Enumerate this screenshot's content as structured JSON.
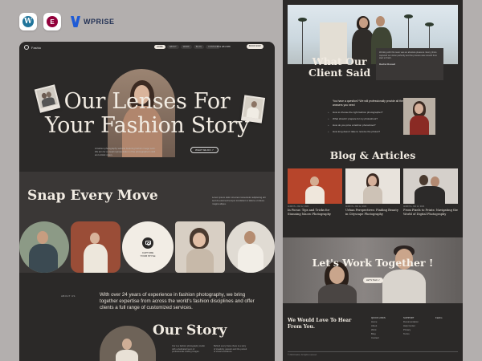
{
  "brand_logos": {
    "wordpress_icon": "W",
    "elementor_icon": "E",
    "wprise_label": "WPRISE"
  },
  "left_page": {
    "brand": "Fashio",
    "nav": [
      "HOME",
      "ABOUT",
      "WORK",
      "BLOG",
      "CONTACT"
    ],
    "phone": "073 284 888",
    "cta": "BOOK NOW",
    "hero": {
      "title_line1": "Our Lenses For",
      "title_line2": "Your Fashion Story",
      "description": "A fashion photography website featuring fashion image work. We aim for a visual representation of the photographer's skill and artistic vision.",
      "button": "WHAT WE DO ↗"
    },
    "snap": {
      "title": "Snap Every Move",
      "description": "Lorem ipsum dolor sit amet consectetur adipiscing elit sed do eiusmod tempor incididunt ut labore et dolore magna aliqua."
    },
    "capture": {
      "line1": "CAPTURE",
      "line2": "YOUR STYLE"
    },
    "about": {
      "label": "ABOUT US",
      "text": "With over 24 years of experience in fashion photography, we bring together expertise from across the world's fashion disciplines and offer clients a full range of customized services."
    },
    "story": {
      "title": "Our Story",
      "col1": "Our is a fashion photography studio with a dedicated team of professionals crafting images.",
      "col2": "Behind every frame there is a story of creativity, passion and the pursuit of visual excellence."
    }
  },
  "right_page": {
    "client": {
      "title_line1": "What Our",
      "title_line2": "Client Said",
      "quote": "Working with this team was an absolute pleasure. Every photo captured our vision perfectly and the process was smooth from start to finish.",
      "name": "Rachel Russell"
    },
    "faq": {
      "head": "You have a question? We will professionally provide all the answers you need",
      "questions": [
        "How to choose the right fashion photographer?",
        "What should I prepare for my photoshoot?",
        "How do you price a fashion photoshoot?",
        "How long does it take to receive the photos?"
      ]
    },
    "blog": {
      "title": "Blog & Articles",
      "posts": [
        {
          "meta": "ALWAYS • JAN 12, 2024",
          "title": "In Focus: Tips and Tricks for Stunning Macro Photography"
        },
        {
          "meta": "ALWAYS • JAN 12, 2024",
          "title": "Urban Perspectives: Finding Beauty in Cityscape Photography"
        },
        {
          "meta": "ALWAYS • JAN 12, 2024",
          "title": "From Pixels to Prints: Navigating the World of Digital Photography"
        }
      ]
    },
    "work": {
      "title": "Let's Work Together !",
      "button": "LET'S TALK ↗"
    },
    "footer": {
      "title_line1": "We Would Love To Hear",
      "title_line2": "From You.",
      "col1_head": "QUICK LINKS",
      "col1": [
        "Home",
        "About",
        "Work",
        "Blog",
        "Contact"
      ],
      "col2_head": "SUPPORT",
      "col2": [
        "Documentation",
        "Help Center",
        "Privacy",
        "Terms"
      ],
      "brand": "Fashio",
      "copyright": "© 2024 Fashio. All rights reserved."
    }
  },
  "colors": {
    "page_bg": "#b3afae",
    "dark_bg": "#2b2928",
    "band_bg": "#3a3736",
    "text_light": "#efe9e1",
    "wordpress": "#21759b",
    "elementor": "#92003b",
    "wprise": "#1e5bd6"
  }
}
